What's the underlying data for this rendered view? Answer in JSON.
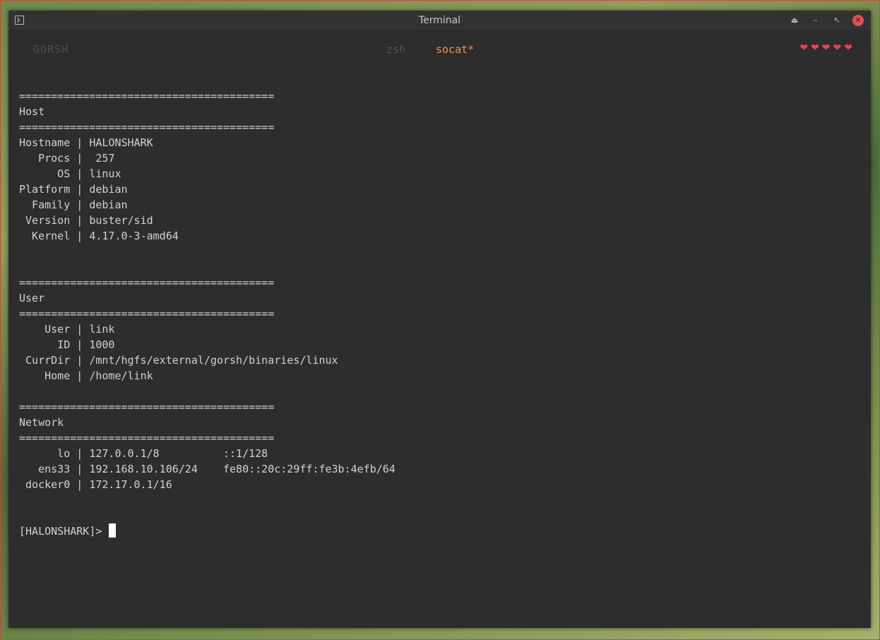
{
  "window": {
    "title": "Terminal"
  },
  "tabs": [
    {
      "label": "GORSH"
    },
    {
      "label": "zsh"
    },
    {
      "label": "socat*"
    }
  ],
  "hearts": "❤❤❤❤❤",
  "icons": {
    "app": "terminal-app-icon",
    "eject": "⏏",
    "minimize": "–",
    "restore": "↖",
    "close": "✕"
  },
  "colors": {
    "background": "#2d2d2d",
    "text": "#d2d2d2",
    "active_tab": "#f0905a",
    "hearts": "#e8454a",
    "close": "#e0505a"
  },
  "terminal": {
    "lines": [
      "========================================",
      "Host",
      "========================================",
      "Hostname | HALONSHARK",
      "   Procs |  257",
      "      OS | linux",
      "Platform | debian",
      "  Family | debian",
      " Version | buster/sid",
      "  Kernel | 4.17.0-3-amd64",
      "",
      "",
      "========================================",
      "User",
      "========================================",
      "    User | link",
      "      ID | 1000",
      " CurrDir | /mnt/hgfs/external/gorsh/binaries/linux",
      "    Home | /home/link",
      "",
      "========================================",
      "Network",
      "========================================",
      "      lo | 127.0.0.1/8          ::1/128",
      "   ens33 | 192.168.10.106/24    fe80::20c:29ff:fe3b:4efb/64",
      " docker0 | 172.17.0.1/16",
      "",
      ""
    ],
    "prompt": "[HALONSHARK]> "
  }
}
